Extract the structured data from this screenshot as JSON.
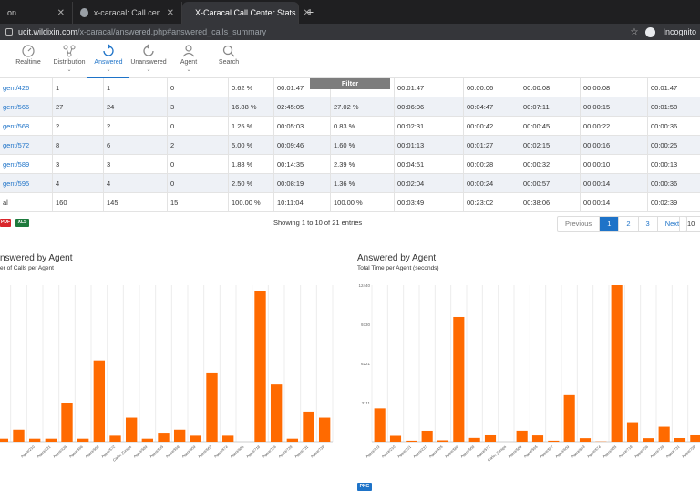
{
  "browser": {
    "tabs": [
      {
        "label": "on",
        "active": false
      },
      {
        "label": "x-caracal: Call center monitori...",
        "active": false
      },
      {
        "label": "X-Caracal Call Center Stats",
        "active": true
      }
    ],
    "new_tab": "+",
    "url_host": "ucit.wildixin.com",
    "url_path": "/x-caracal/answered.php#answered_calls_summary",
    "profile_label": "Incognito"
  },
  "nav": {
    "items": [
      {
        "label": "Realtime",
        "icon": "gauge-icon"
      },
      {
        "label": "Distribution",
        "icon": "distribution-icon"
      },
      {
        "label": "Answered",
        "icon": "answered-icon",
        "active": true
      },
      {
        "label": "Unanswered",
        "icon": "unanswered-icon"
      },
      {
        "label": "Agent",
        "icon": "agent-icon"
      },
      {
        "label": "Search",
        "icon": "search-icon"
      }
    ]
  },
  "table": {
    "filter_label": "Filter",
    "rows": [
      [
        "gent/426",
        "1",
        "1",
        "0",
        "0.62 %",
        "00:01:47",
        "",
        "00:01:47",
        "00:00:06",
        "00:00:08",
        "00:00:08",
        "00:01:47"
      ],
      [
        "gent/566",
        "27",
        "24",
        "3",
        "16.88 %",
        "02:45:05",
        "27.02 %",
        "00:06:06",
        "00:04:47",
        "00:07:11",
        "00:00:15",
        "00:01:58"
      ],
      [
        "gent/568",
        "2",
        "2",
        "0",
        "1.25 %",
        "00:05:03",
        "0.83 %",
        "00:02:31",
        "00:00:42",
        "00:00:45",
        "00:00:22",
        "00:00:36"
      ],
      [
        "gent/572",
        "8",
        "6",
        "2",
        "5.00 %",
        "00:09:46",
        "1.60 %",
        "00:01:13",
        "00:01:27",
        "00:02:15",
        "00:00:16",
        "00:00:25"
      ],
      [
        "gent/589",
        "3",
        "3",
        "0",
        "1.88 %",
        "00:14:35",
        "2.39 %",
        "00:04:51",
        "00:00:28",
        "00:00:32",
        "00:00:10",
        "00:00:13"
      ],
      [
        "gent/595",
        "4",
        "4",
        "0",
        "2.50 %",
        "00:08:19",
        "1.36 %",
        "00:02:04",
        "00:00:24",
        "00:00:57",
        "00:00:14",
        "00:00:36"
      ],
      [
        "al",
        "160",
        "145",
        "15",
        "100.00 %",
        "10:11:04",
        "100.00 %",
        "00:03:49",
        "00:23:02",
        "00:38:06",
        "00:00:14",
        "00:02:39"
      ]
    ]
  },
  "export": {
    "pdf": "PDF",
    "xls": "XLS",
    "png": "PNG"
  },
  "entries_text": "Showing 1 to 10 of 21 entries",
  "pager": {
    "previous": "Previous",
    "pages": [
      "1",
      "2",
      "3"
    ],
    "next": "Next",
    "page_size": "10"
  },
  "colors": {
    "bar": "#ff6a00",
    "link": "#1e73c8"
  },
  "chart_data": [
    {
      "type": "bar",
      "title": "nswered by Agent",
      "subtitle": "er of Calls per Agent",
      "categories": [
        "Agent/210",
        "Agent/221",
        "Agent/426",
        "Agent/566",
        "Agent/568",
        "Agent/572",
        "Carlos Zuniga",
        "Agent/589",
        "Agent/595",
        "Agent/598",
        "Agent/609",
        "Agent/663",
        "Agent/674",
        "Agent/685",
        "Agent/718",
        "Agent/726",
        "Agent/728",
        "Agent/731",
        "Agent/738"
      ],
      "series": [
        {
          "values": [
            1,
            4,
            1,
            1,
            13,
            1,
            27,
            2,
            8,
            1,
            3,
            4,
            2,
            23,
            2,
            0,
            50,
            19,
            1,
            10,
            8
          ]
        }
      ],
      "ylim": [
        0,
        52
      ]
    },
    {
      "type": "bar",
      "title": "Answered by Agent",
      "subtitle": "Total Time per Agent (seconds)",
      "yticks": [
        "12440",
        "9330",
        "6221",
        "3111"
      ],
      "categories": [
        "Agent/303",
        "Agent/210",
        "Agent/221",
        "Agent/237",
        "Agent/426",
        "Agent/566",
        "Agent/568",
        "Agent/572",
        "Carlos Zuniga",
        "Agent/589",
        "Agent/595",
        "Agent/597",
        "Agent/609",
        "Agent/663",
        "Agent/674",
        "Agent/685",
        "Agent/718",
        "Agent/726",
        "Agent/728",
        "Agent/731",
        "Agent/738"
      ],
      "series": [
        {
          "values": [
            2650,
            470,
            80,
            870,
            110,
            9910,
            300,
            580,
            0,
            875,
            500,
            80,
            3700,
            280,
            20,
            12440,
            1550,
            280,
            1190,
            290,
            580
          ]
        }
      ],
      "ylim": [
        0,
        12440
      ]
    }
  ]
}
